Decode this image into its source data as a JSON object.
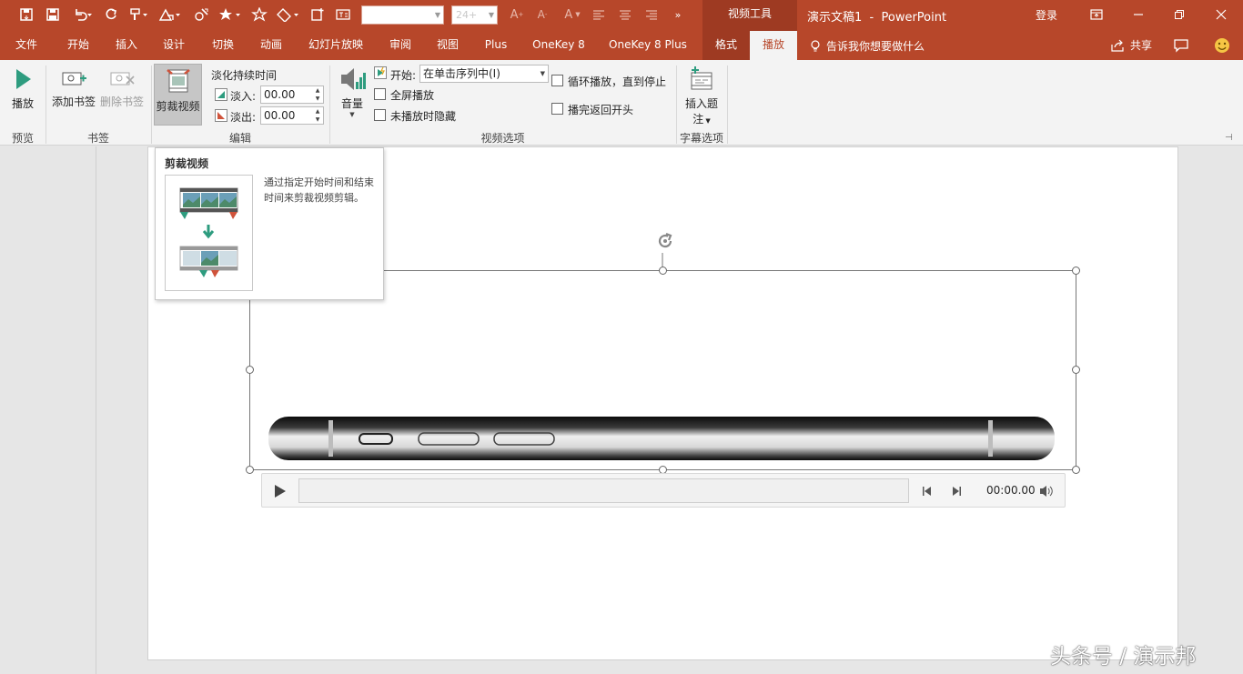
{
  "qat": {
    "font_name": "",
    "font_size": "24+",
    "icons": [
      "autosave-icon",
      "save-icon",
      "undo-icon",
      "redo-icon",
      "format-painter-icon",
      "shapes-icon",
      "arrange-icon",
      "quick-styles-icon",
      "effects-icon",
      "outline-icon",
      "new-slide-icon",
      "textbox-icon",
      "increase-font-icon",
      "decrease-font-icon",
      "font-color-icon",
      "align-left-icon",
      "align-center-icon",
      "align-right-icon",
      "more-icon"
    ]
  },
  "title": {
    "context_header": "视频工具",
    "document": "演示文稿1  -  PowerPoint",
    "login": "登录"
  },
  "tabs": [
    {
      "label": "文件"
    },
    {
      "label": "开始"
    },
    {
      "label": "插入"
    },
    {
      "label": "设计"
    },
    {
      "label": "切换"
    },
    {
      "label": "动画"
    },
    {
      "label": "幻灯片放映"
    },
    {
      "label": "审阅"
    },
    {
      "label": "视图"
    },
    {
      "label": "Plus"
    },
    {
      "label": "OneKey 8"
    },
    {
      "label": "OneKey 8 Plus"
    },
    {
      "label": "格式"
    },
    {
      "label": "播放"
    }
  ],
  "tellme": "告诉我你想要做什么",
  "share": "共享",
  "ribbon": {
    "play": "播放",
    "add_bookmark": "添加书签",
    "remove_bookmark": "删除书签",
    "trim_video": "剪裁视频",
    "fade_duration": "淡化持续时间",
    "fade_in_label": "淡入:",
    "fade_in_value": "00.00",
    "fade_out_label": "淡出:",
    "fade_out_value": "00.00",
    "volume": "音量",
    "start_label": "开始:",
    "start_value": "在单击序列中(I)",
    "fullscreen": "全屏播放",
    "hide_not_playing": "未播放时隐藏",
    "loop": "循环播放，直到停止",
    "rewind": "播完返回开头",
    "insert_caption_1": "插入题",
    "insert_caption_2": "注",
    "groups": {
      "preview": "预览",
      "bookmarks": "书签",
      "editing": "编辑",
      "video_options": "视频选项",
      "caption_options": "字幕选项"
    }
  },
  "tooltip": {
    "title": "剪裁视频",
    "description": "通过指定开始时间和结束时间来剪裁视频剪辑。"
  },
  "player": {
    "time": "00:00.00"
  },
  "watermark": "头条号 / 演示邦",
  "colors": {
    "brand": "#b7472a",
    "context": "#9e3a22"
  }
}
